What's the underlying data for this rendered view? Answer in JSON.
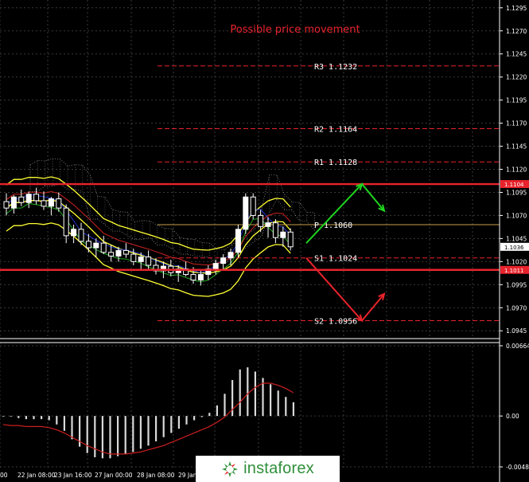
{
  "chart_data": [
    {
      "type": "line",
      "title": "Possible price movement",
      "ylim": [
        1.094,
        1.13
      ],
      "y_ticks": [
        "1.1295",
        "1.1270",
        "1.1245",
        "1.1220",
        "1.1195",
        "1.1170",
        "1.1145",
        "1.1120",
        "1.1095",
        "1.1070",
        "1.1045",
        "1.1020",
        "1.0995",
        "1.0970",
        "1.0945"
      ],
      "x_ticks": [
        "00",
        "22 Jan 08:00",
        "23 Jan 16:00",
        "27 Jan 00:00",
        "28 Jan 08:00",
        "29 Jan"
      ],
      "price_tags": [
        {
          "label": "1.1104",
          "value": 1.1104,
          "color": "#e8232c"
        },
        {
          "label": "1.1036",
          "value": 1.1036,
          "color": "#ffffff"
        },
        {
          "label": "1.1011",
          "value": 1.1011,
          "color": "#e8232c"
        }
      ],
      "levels": [
        {
          "label": "R3 1.1232",
          "value": 1.1232
        },
        {
          "label": "R2 1.1164",
          "value": 1.1164
        },
        {
          "label": "R1 1.1128",
          "value": 1.1128
        },
        {
          "label": "P 1.1060",
          "value": 1.106
        },
        {
          "label": "S1 1.1024",
          "value": 1.1024
        },
        {
          "label": "S2 1.0956",
          "value": 1.0956
        }
      ],
      "support_resistance": [
        1.1104,
        1.1011
      ],
      "scenarios": [
        {
          "direction": "up",
          "color": "#1fd51f",
          "path": [
            [
              1.104
            ],
            [
              1.1104
            ],
            [
              1.1075
            ]
          ]
        },
        {
          "direction": "down",
          "color": "#e8232c",
          "path": [
            [
              1.1024
            ],
            [
              1.0956
            ],
            [
              1.0985
            ]
          ]
        }
      ],
      "candles": [
        {
          "o": 1.1085,
          "h": 1.1094,
          "l": 1.107,
          "c": 1.1078
        },
        {
          "o": 1.1078,
          "h": 1.1092,
          "l": 1.1072,
          "c": 1.109
        },
        {
          "o": 1.109,
          "h": 1.1098,
          "l": 1.108,
          "c": 1.1084
        },
        {
          "o": 1.1084,
          "h": 1.1096,
          "l": 1.1078,
          "c": 1.1093
        },
        {
          "o": 1.1093,
          "h": 1.11,
          "l": 1.1082,
          "c": 1.1086
        },
        {
          "o": 1.1086,
          "h": 1.1096,
          "l": 1.1076,
          "c": 1.108
        },
        {
          "o": 1.108,
          "h": 1.109,
          "l": 1.107,
          "c": 1.1088
        },
        {
          "o": 1.1088,
          "h": 1.1095,
          "l": 1.1074,
          "c": 1.1078
        },
        {
          "o": 1.1078,
          "h": 1.1082,
          "l": 1.104,
          "c": 1.1048
        },
        {
          "o": 1.1048,
          "h": 1.106,
          "l": 1.104,
          "c": 1.1055
        },
        {
          "o": 1.1055,
          "h": 1.1062,
          "l": 1.1038,
          "c": 1.1042
        },
        {
          "o": 1.1042,
          "h": 1.105,
          "l": 1.103,
          "c": 1.1035
        },
        {
          "o": 1.1035,
          "h": 1.1045,
          "l": 1.1025,
          "c": 1.104
        },
        {
          "o": 1.104,
          "h": 1.1048,
          "l": 1.1028,
          "c": 1.103
        },
        {
          "o": 1.103,
          "h": 1.1038,
          "l": 1.102,
          "c": 1.1026
        },
        {
          "o": 1.1026,
          "h": 1.1036,
          "l": 1.102,
          "c": 1.1032
        },
        {
          "o": 1.1032,
          "h": 1.104,
          "l": 1.1024,
          "c": 1.1028
        },
        {
          "o": 1.1028,
          "h": 1.1034,
          "l": 1.1016,
          "c": 1.102
        },
        {
          "o": 1.102,
          "h": 1.103,
          "l": 1.1012,
          "c": 1.1025
        },
        {
          "o": 1.1025,
          "h": 1.1032,
          "l": 1.1012,
          "c": 1.1016
        },
        {
          "o": 1.1016,
          "h": 1.1024,
          "l": 1.1006,
          "c": 1.101
        },
        {
          "o": 1.101,
          "h": 1.102,
          "l": 1.1002,
          "c": 1.1015
        },
        {
          "o": 1.1015,
          "h": 1.1022,
          "l": 1.1004,
          "c": 1.1008
        },
        {
          "o": 1.1008,
          "h": 1.1016,
          "l": 1.0998,
          "c": 1.1012
        },
        {
          "o": 1.1012,
          "h": 1.102,
          "l": 1.1004,
          "c": 1.1006
        },
        {
          "o": 1.1006,
          "h": 1.1014,
          "l": 1.0996,
          "c": 1.1
        },
        {
          "o": 1.1,
          "h": 1.101,
          "l": 1.0994,
          "c": 1.1006
        },
        {
          "o": 1.1006,
          "h": 1.1016,
          "l": 1.1,
          "c": 1.1012
        },
        {
          "o": 1.1012,
          "h": 1.1022,
          "l": 1.1006,
          "c": 1.1018
        },
        {
          "o": 1.1018,
          "h": 1.1028,
          "l": 1.101,
          "c": 1.1024
        },
        {
          "o": 1.1024,
          "h": 1.1034,
          "l": 1.1016,
          "c": 1.103
        },
        {
          "o": 1.103,
          "h": 1.106,
          "l": 1.1024,
          "c": 1.1055
        },
        {
          "o": 1.1055,
          "h": 1.1094,
          "l": 1.105,
          "c": 1.109
        },
        {
          "o": 1.109,
          "h": 1.1094,
          "l": 1.1066,
          "c": 1.107
        },
        {
          "o": 1.107,
          "h": 1.1076,
          "l": 1.1052,
          "c": 1.1058
        },
        {
          "o": 1.1058,
          "h": 1.1068,
          "l": 1.1046,
          "c": 1.1062
        },
        {
          "o": 1.1062,
          "h": 1.1066,
          "l": 1.104,
          "c": 1.1046
        },
        {
          "o": 1.1046,
          "h": 1.1058,
          "l": 1.1036,
          "c": 1.1052
        },
        {
          "o": 1.1052,
          "h": 1.1056,
          "l": 1.1032,
          "c": 1.1036
        }
      ]
    },
    {
      "type": "bar",
      "ylim": [
        -0.00481,
        0.00664
      ],
      "y_ticks": [
        "0.00664",
        "0.00",
        "-0.00481"
      ],
      "values": [
        0.0,
        0.0,
        -0.0002,
        -0.0003,
        -0.0003,
        -0.0003,
        -0.0004,
        -0.0008,
        -0.0014,
        -0.0022,
        -0.0029,
        -0.0035,
        -0.0039,
        -0.004,
        -0.004,
        -0.0038,
        -0.0036,
        -0.0034,
        -0.0031,
        -0.0028,
        -0.0024,
        -0.002,
        -0.0016,
        -0.0012,
        -0.0008,
        -0.0004,
        -0.0001,
        0.0003,
        0.001,
        0.0021,
        0.0034,
        0.0044,
        0.0046,
        0.0042,
        0.0036,
        0.003,
        0.0024,
        0.0018,
        0.0013
      ],
      "signal": [
        -0.0008,
        -0.0009,
        -0.0009,
        -0.001,
        -0.001,
        -0.001,
        -0.0011,
        -0.0013,
        -0.0016,
        -0.002,
        -0.0024,
        -0.0028,
        -0.0031,
        -0.0034,
        -0.0036,
        -0.0036,
        -0.0036,
        -0.0035,
        -0.0034,
        -0.0032,
        -0.003,
        -0.0028,
        -0.0025,
        -0.0022,
        -0.0019,
        -0.0016,
        -0.0013,
        -0.001,
        -0.0006,
        -0.0001,
        0.0006,
        0.0013,
        0.0021,
        0.0027,
        0.0031,
        0.0031,
        0.0029,
        0.0026,
        0.0022
      ]
    }
  ],
  "logo": {
    "text": "instaforex"
  }
}
